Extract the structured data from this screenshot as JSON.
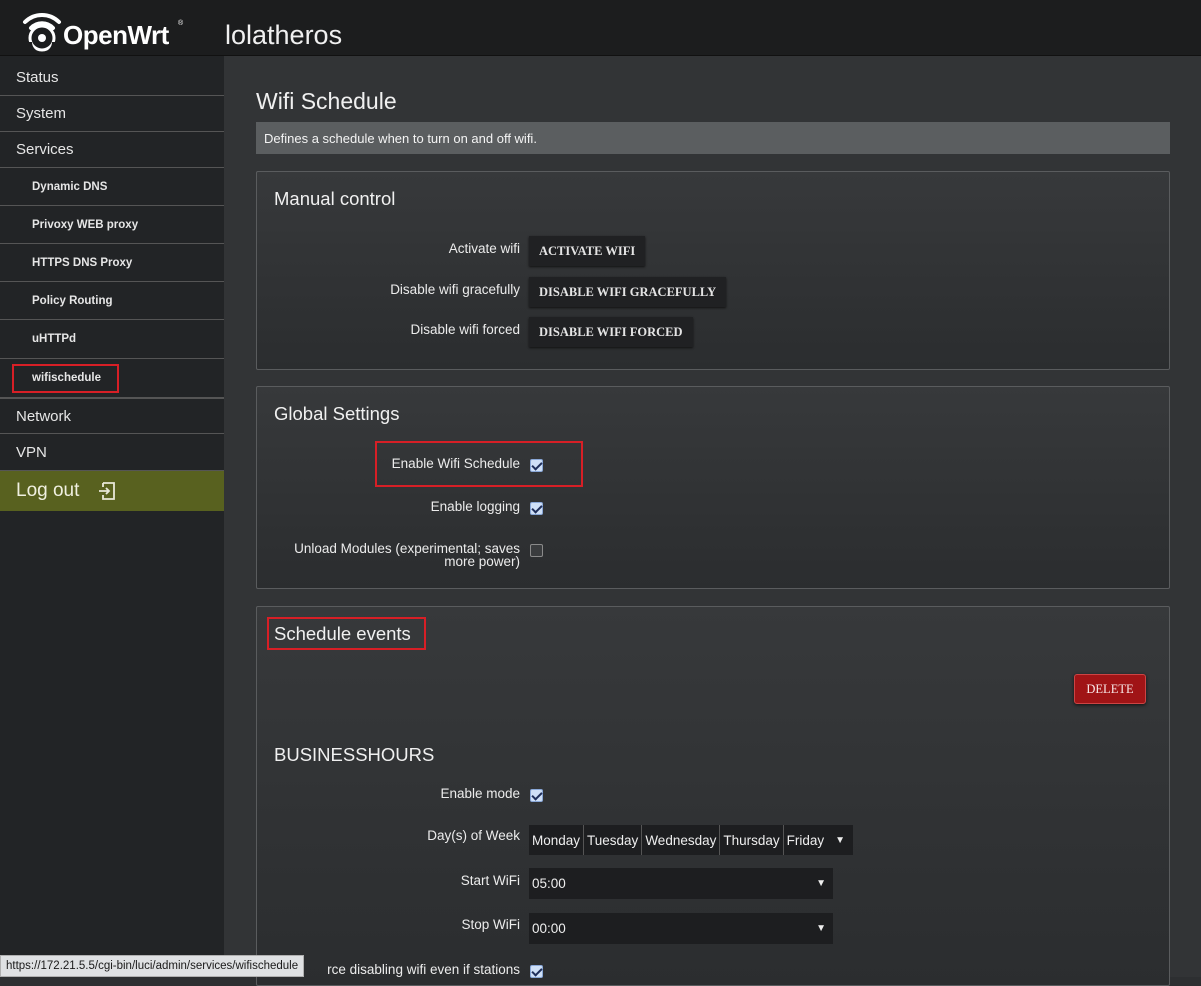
{
  "header": {
    "logo_text": "OpenWrt",
    "logo_mark": "®",
    "hostname": "lolatheros"
  },
  "sidebar": {
    "status": "Status",
    "system": "System",
    "services": "Services",
    "sub_items": [
      "Dynamic DNS",
      "Privoxy WEB proxy",
      "HTTPS DNS Proxy",
      "Policy Routing",
      "uHTTPd",
      "wifischedule"
    ],
    "network": "Network",
    "vpn": "VPN",
    "logout": "Log out"
  },
  "page": {
    "title": "Wifi Schedule",
    "description": "Defines a schedule when to turn on and off wifi."
  },
  "manual": {
    "title": "Manual control",
    "activate_label": "Activate wifi",
    "activate_button": "ACTIVATE WIFI",
    "graceful_label": "Disable wifi gracefully",
    "graceful_button": "DISABLE WIFI GRACEFULLY",
    "forced_label": "Disable wifi forced",
    "forced_button": "DISABLE WIFI FORCED"
  },
  "global": {
    "title": "Global Settings",
    "enable_schedule_label": "Enable Wifi Schedule",
    "enable_schedule_checked": true,
    "enable_logging_label": "Enable logging",
    "enable_logging_checked": true,
    "unload_label_1": "Unload Modules (experimental; saves",
    "unload_label_2": "more power)",
    "unload_checked": false
  },
  "schedule": {
    "title": "Schedule events",
    "delete_button": "DELETE",
    "entry_name": "BUSINESSHOURS",
    "enable_mode_label": "Enable mode",
    "enable_mode_checked": true,
    "days_label": "Day(s) of Week",
    "days": [
      "Monday",
      "Tuesday",
      "Wednesday",
      "Thursday",
      "Friday"
    ],
    "start_label": "Start WiFi",
    "start_value": "05:00",
    "stop_label": "Stop WiFi",
    "stop_value": "00:00",
    "force_label_partial": "rce disabling wifi even if stations",
    "force_checked": true
  },
  "statusbar": {
    "url": "https://172.21.5.5/cgi-bin/luci/admin/services/wifischedule"
  },
  "colors": {
    "highlight": "#d71f26",
    "logout_bg": "#58611f",
    "delete_bg": "#a01416"
  }
}
